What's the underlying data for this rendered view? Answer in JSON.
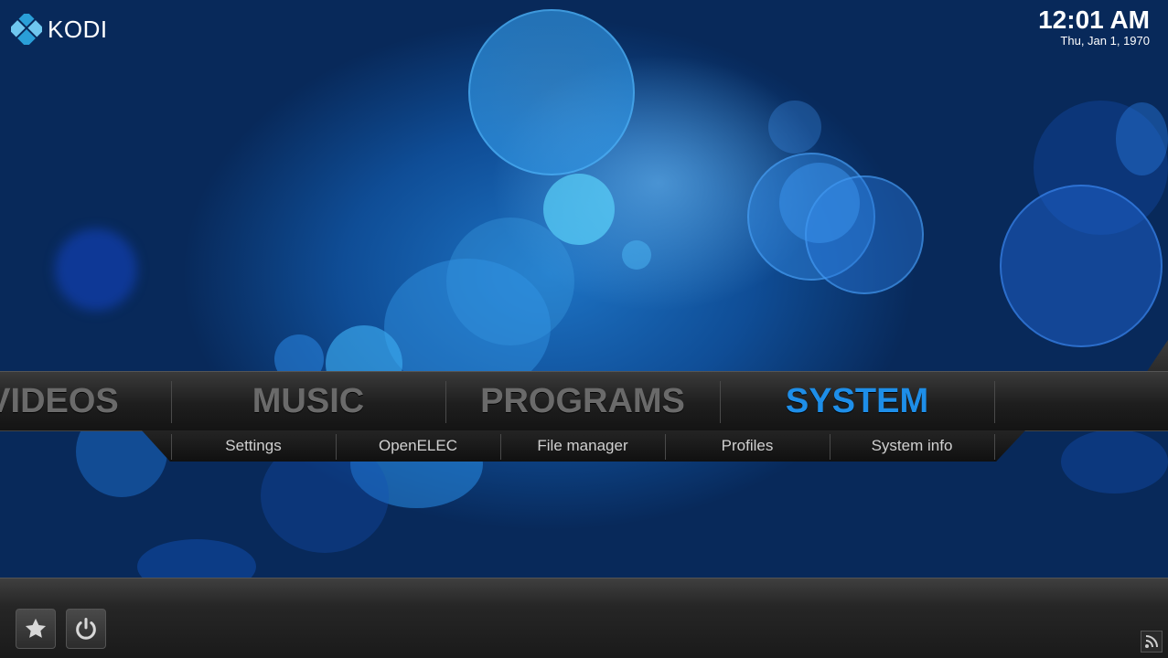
{
  "app": {
    "name": "KODI"
  },
  "clock": {
    "time": "12:01 AM",
    "date": "Thu, Jan 1, 1970"
  },
  "main_menu": {
    "items": [
      {
        "label": "VIDEOS",
        "active": false
      },
      {
        "label": "MUSIC",
        "active": false
      },
      {
        "label": "PROGRAMS",
        "active": false
      },
      {
        "label": "SYSTEM",
        "active": true
      }
    ],
    "active_color": "#1e8ee8",
    "inactive_color": "#6a6a6a"
  },
  "sub_menu": {
    "items": [
      "Settings",
      "OpenELEC",
      "File manager",
      "Profiles",
      "System info"
    ]
  },
  "footer": {
    "buttons": [
      {
        "icon": "star-icon",
        "purpose": "favourites"
      },
      {
        "icon": "power-icon",
        "purpose": "power"
      }
    ],
    "rss_icon": "rss-icon"
  }
}
